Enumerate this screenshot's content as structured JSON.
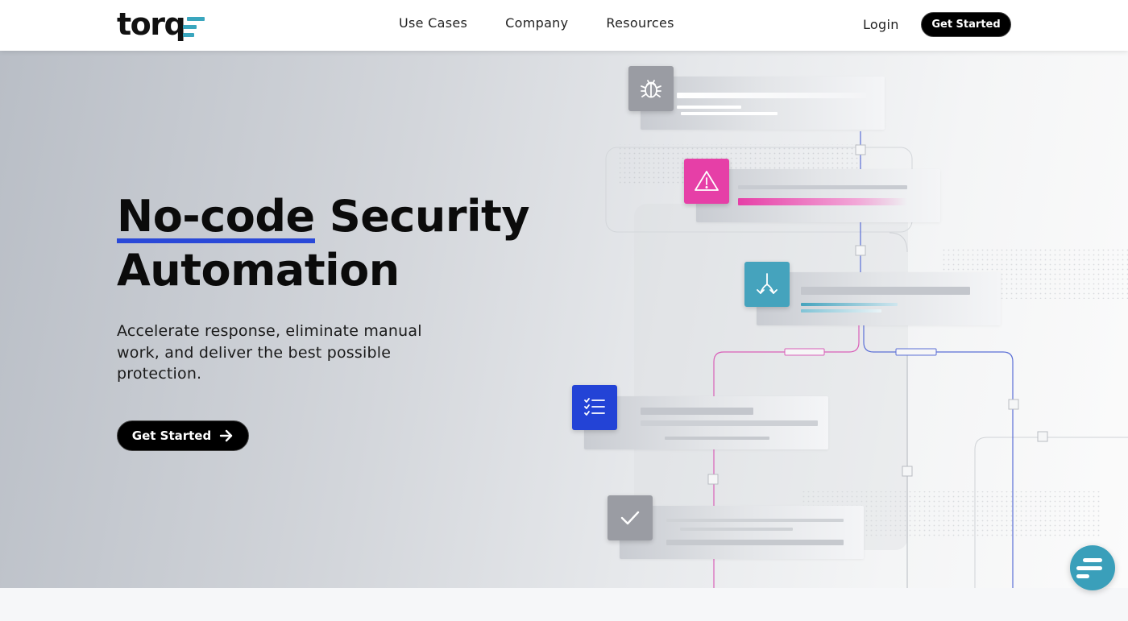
{
  "header": {
    "logo_text": "torq",
    "nav": [
      "Use Cases",
      "Company",
      "Resources"
    ],
    "login_label": "Login",
    "cta_label": "Get Started"
  },
  "hero": {
    "title_highlight": "No-code",
    "title_rest": " Security",
    "title_line2": "Automation",
    "subtitle": "Accelerate response, eliminate manual work, and deliver the best possible protection.",
    "cta_label": "Get Started"
  },
  "workflow": {
    "steps": [
      {
        "icon": "bug-icon",
        "color": "#9a9ca3"
      },
      {
        "icon": "warning-icon",
        "color": "#e63fa7"
      },
      {
        "icon": "branch-icon",
        "color": "#45a3bd"
      },
      {
        "icon": "checklist-icon",
        "color": "#2343d6"
      },
      {
        "icon": "checkmark-icon",
        "color": "#9a9ca3"
      }
    ]
  },
  "colors": {
    "accent_blue": "#2a49d8",
    "teal": "#3aa6be",
    "pink": "#e63fa7"
  }
}
